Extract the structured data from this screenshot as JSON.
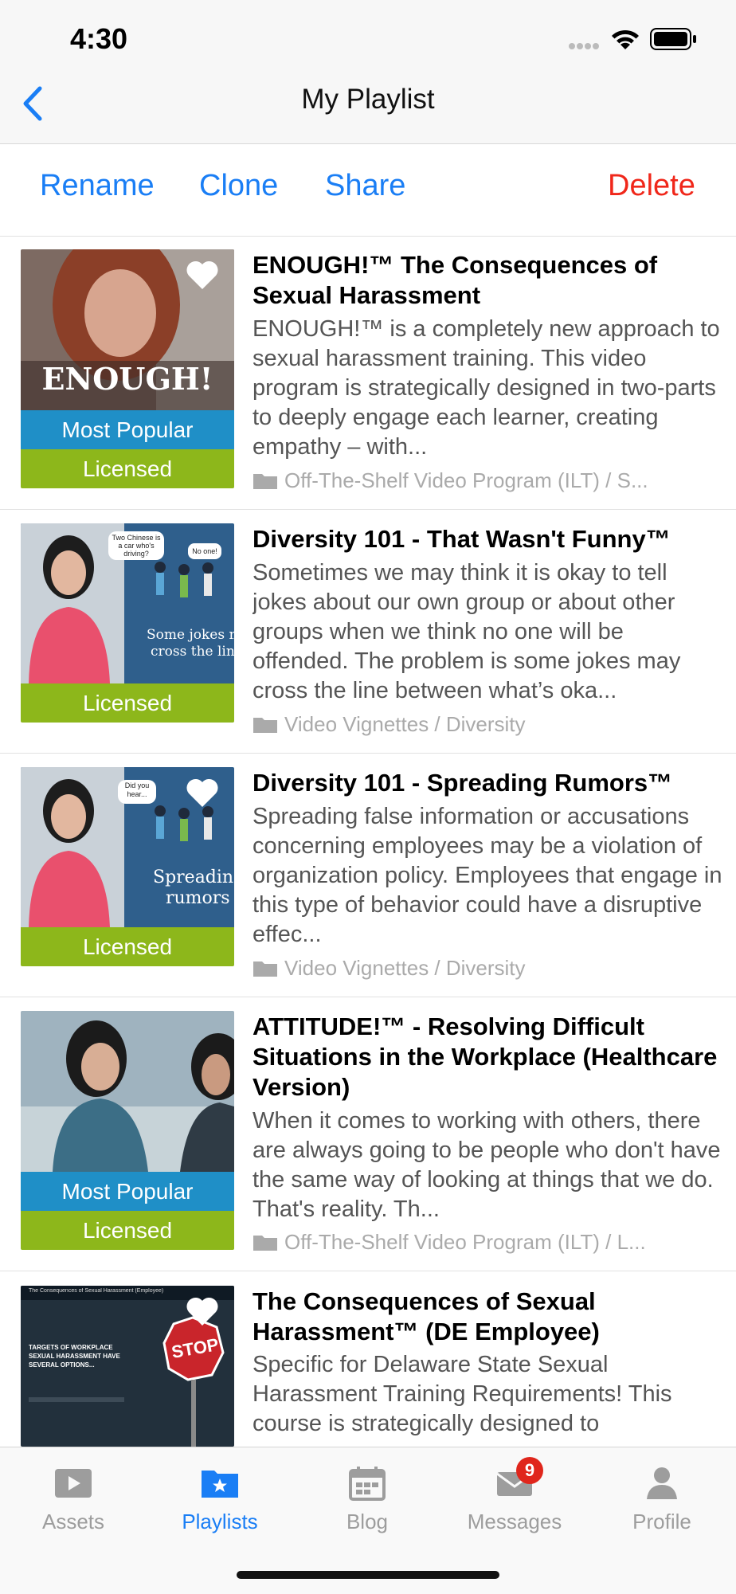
{
  "status": {
    "time": "4:30"
  },
  "nav": {
    "title": "My Playlist"
  },
  "actions": {
    "rename": "Rename",
    "clone": "Clone",
    "share": "Share",
    "delete": "Delete"
  },
  "items": [
    {
      "title": "ENOUGH!™ The Consequences of Sexual Harassment",
      "description": "ENOUGH!™ is a completely new approach to sexual harassment training. This video program is strategically designed in two-parts to deeply engage each learner, creating empathy – with...",
      "category": "Off-The-Shelf Video Program (ILT) / S...",
      "thumb_text": "ENOUGH!",
      "badge_popular": "Most Popular",
      "badge_licensed": "Licensed"
    },
    {
      "title": "Diversity 101 - That Wasn't Funny™",
      "description": "Sometimes we may think it is okay to tell jokes about our own group or about other groups when we think no one will be offended. The problem is some jokes may cross the line between what’s oka...",
      "category": "Video Vignettes / Diversity",
      "thumb_text_1": "Some jokes ma",
      "thumb_text_2": "cross the line",
      "bubble_1": "Two Chinese is a car who's driving?",
      "bubble_2": "No one!",
      "badge_licensed": "Licensed"
    },
    {
      "title": "Diversity 101 - Spreading Rumors™",
      "description": "Spreading false information or accusations concerning employees may be a violation of organization policy. Employees that engage in this type of behavior could have a disruptive effec...",
      "category": "Video Vignettes / Diversity",
      "thumb_text_1": "Spreading",
      "thumb_text_2": "rumors",
      "bubble_1": "Did you hear...",
      "badge_licensed": "Licensed"
    },
    {
      "title": "ATTITUDE!™ - Resolving Difficult Situations in the Workplace (Healthcare Version)",
      "description": "When it comes to working with others, there are always going to be people who don't have the same way of looking at things that we do. That's reality. Th...",
      "category": "Off-The-Shelf Video Program (ILT) / L...",
      "badge_popular": "Most Popular",
      "badge_licensed": "Licensed"
    },
    {
      "title": "The Consequences of Sexual Harassment™ (DE Employee)",
      "description": "Specific for Delaware State Sexual Harassment Training Requirements! This course is strategically designed to",
      "slide_header": "The Consequences of Sexual Harassment (Employee)",
      "slide_text": "TARGETS OF WORKPLACE SEXUAL HARASSMENT HAVE SEVERAL OPTIONS...",
      "stop_text": "STOP"
    }
  ],
  "tabs": [
    {
      "label": "Assets",
      "icon": "play-icon"
    },
    {
      "label": "Playlists",
      "icon": "star-folder-icon"
    },
    {
      "label": "Blog",
      "icon": "calendar-icon"
    },
    {
      "label": "Messages",
      "icon": "envelope-icon",
      "badge": "9"
    },
    {
      "label": "Profile",
      "icon": "person-icon"
    }
  ],
  "colors": {
    "accent": "#1a7ef5",
    "delete": "#f0271a",
    "popular": "#1f8fc7",
    "licensed": "#8db71b"
  }
}
